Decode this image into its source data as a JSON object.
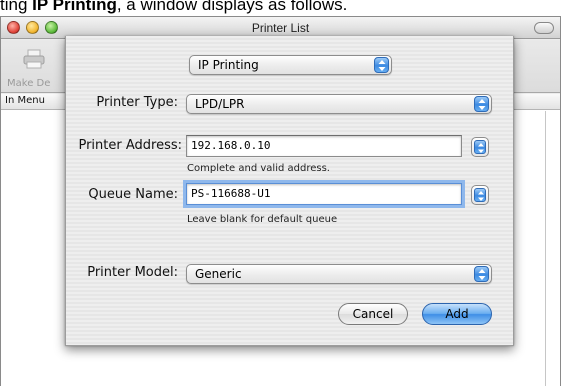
{
  "caption": {
    "prefix": "ting ",
    "bold": "IP Printing",
    "suffix": ", a window displays as follows."
  },
  "window": {
    "title": "Printer List"
  },
  "toolbar": {
    "make_default_label": "Make De",
    "make_default_icon": "printer-icon"
  },
  "list": {
    "header_label": "In Menu"
  },
  "sheet": {
    "protocol_value": "IP Printing",
    "printer_type_label": "Printer Type:",
    "printer_type_value": "LPD/LPR",
    "printer_address_label": "Printer Address:",
    "printer_address_value": "192.168.0.10",
    "printer_address_hint": "Complete and valid address.",
    "queue_name_label": "Queue Name:",
    "queue_name_value": "PS-116688-U1",
    "queue_name_hint": "Leave blank for default queue",
    "printer_model_label": "Printer Model:",
    "printer_model_value": "Generic",
    "cancel_label": "Cancel",
    "add_label": "Add"
  },
  "colors": {
    "accent": "#3c8ae2",
    "focus_ring": "#8fb8ec"
  }
}
